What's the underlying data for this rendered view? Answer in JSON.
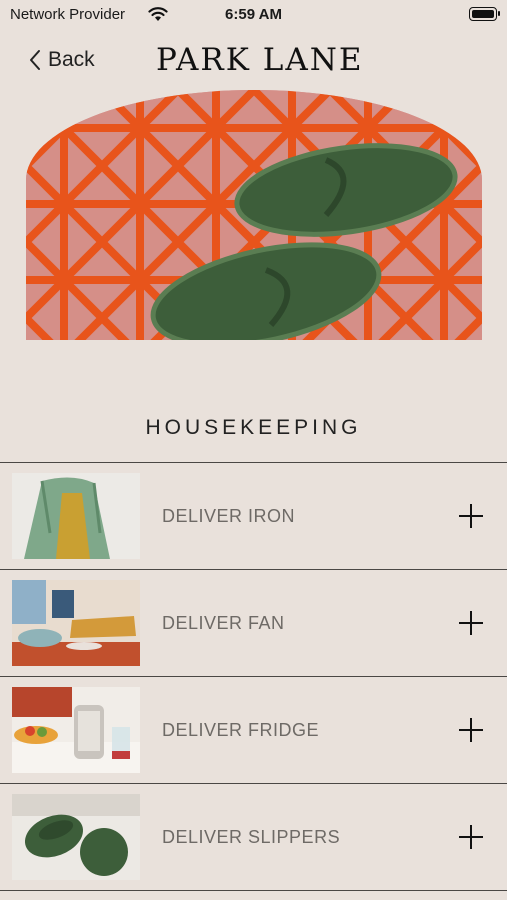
{
  "status_bar": {
    "carrier": "Network Provider",
    "time": "6:59 AM"
  },
  "nav": {
    "back_label": "Back",
    "brand": "PARK LANE"
  },
  "hero": {
    "alt": "green slippers on patterned carpet"
  },
  "section": {
    "title": "HOUSEKEEPING"
  },
  "items": [
    {
      "label": "DELIVER IRON",
      "thumb": "green robe"
    },
    {
      "label": "DELIVER FAN",
      "thumb": "hotel lounge"
    },
    {
      "label": "DELIVER FRIDGE",
      "thumb": "breakfast table"
    },
    {
      "label": "DELIVER SLIPPERS",
      "thumb": "green slippers"
    }
  ],
  "icons": {
    "back": "chevron-left-icon",
    "add": "plus-icon",
    "wifi": "wifi-icon",
    "battery": "battery-icon"
  },
  "colors": {
    "background": "#e9e1db",
    "accent_orange": "#e8541b",
    "slipper_green": "#3d5e3a"
  }
}
